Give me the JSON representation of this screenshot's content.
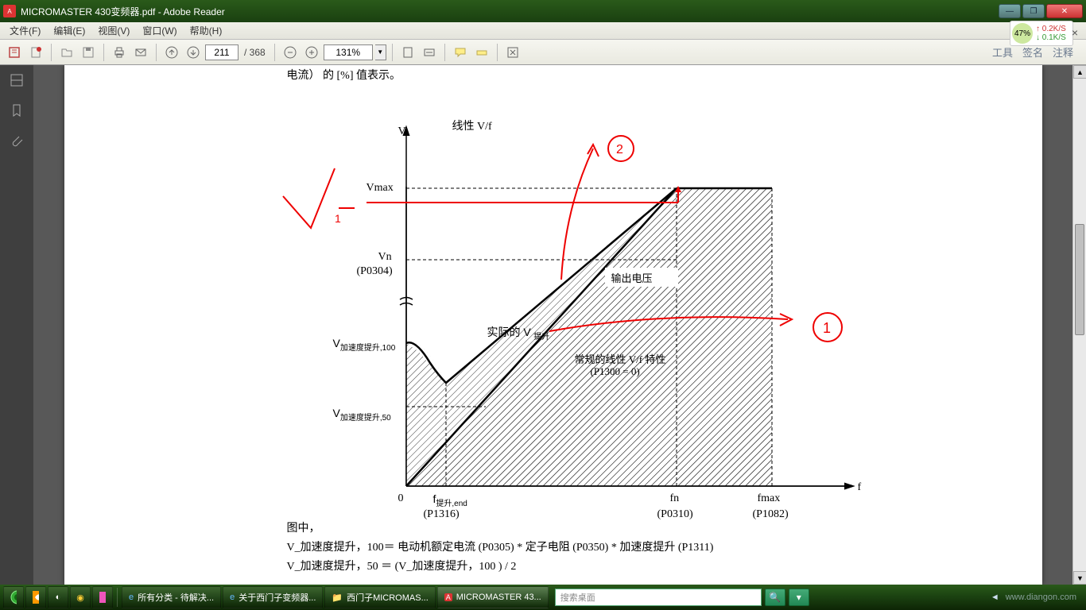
{
  "window": {
    "title": "MICROMASTER 430变频器.pdf - Adobe Reader",
    "min": "—",
    "max": "❐",
    "close": "✕"
  },
  "menu": {
    "file": "文件(F)",
    "edit": "编辑(E)",
    "view": "视图(V)",
    "window": "窗口(W)",
    "help": "帮助(H)"
  },
  "netspeed": {
    "percent": "47%",
    "up": "↑ 0.2K/S",
    "down": "↓ 0.1K/S"
  },
  "toolbar": {
    "page_current": "211",
    "page_total": "/ 368",
    "zoom": "131%",
    "tools": "工具",
    "sign": "签名",
    "comment": "注释"
  },
  "document": {
    "top_line": "电流）  的 [%] 值表示。",
    "chart": {
      "title": "线性 V/f",
      "y_axis": "V",
      "x_axis": "f",
      "vmax": "Vmax",
      "vn": "Vn",
      "vn_param": "(P0304)",
      "v_accel_100": "V",
      "v_accel_100_sub": "加速度提升,100",
      "v_accel_50": "V",
      "v_accel_50_sub": "加速度提升,50",
      "origin": "0",
      "f_boost_end": "f",
      "f_boost_end_sub": "提升,end",
      "f_boost_param": "(P1316)",
      "fn": "fn",
      "fn_param": "(P0310)",
      "fmax": "fmax",
      "fmax_param": "(P1082)",
      "actual_v": "实际的  V",
      "actual_v_sub": "提升",
      "output_voltage": "输出电压",
      "normal_vf": "常规的线性 V/f 特性",
      "normal_vf_param": "(P1300 = 0)"
    },
    "footer1": "图中，",
    "footer2": "V_加速度提升，100＝ 电动机额定电流 (P0305) * 定子电阻 (P0350) * 加速度提升 (P1311)",
    "footer3": "V_加速度提升，50  ＝  (V_加速度提升，100 ) / 2"
  },
  "taskbar": {
    "items": [
      "所有分类 - 待解决...",
      "关于西门子变频器...",
      "西门子MICROMAS...",
      "MICROMASTER 43..."
    ],
    "search_placeholder": "搜索桌面",
    "watermark": "www.diangon.com"
  },
  "chart_data": {
    "type": "line",
    "title": "线性 V/f",
    "xlabel": "f",
    "ylabel": "V",
    "x_ticks": [
      {
        "label": "0",
        "param": ""
      },
      {
        "label": "f_提升,end",
        "param": "P1316"
      },
      {
        "label": "fn",
        "param": "P0310"
      },
      {
        "label": "fmax",
        "param": "P1082"
      }
    ],
    "y_ticks": [
      {
        "label": "V_加速度提升,50",
        "param": ""
      },
      {
        "label": "V_加速度提升,100",
        "param": ""
      },
      {
        "label": "Vn",
        "param": "P0304"
      },
      {
        "label": "Vmax",
        "param": ""
      }
    ],
    "series": [
      {
        "name": "常规的线性 V/f 特性 (P1300=0)",
        "points": [
          [
            0,
            0
          ],
          [
            "fn",
            "Vn"
          ],
          [
            "fmax",
            "Vmax"
          ]
        ]
      },
      {
        "name": "实际的 V 提升 (含加速度提升)",
        "points": [
          [
            0,
            "V_加速度提升,100"
          ],
          [
            "f_提升,end",
            "V_boost"
          ],
          [
            "fn",
            "Vn"
          ],
          [
            "fmax",
            "Vmax"
          ]
        ]
      }
    ],
    "shaded_region": "输出电压 (两曲线之间)",
    "annotations_handwritten": [
      "V₁ (左侧红字)",
      "① (右侧红圈)",
      "② (上方红圈)"
    ]
  }
}
